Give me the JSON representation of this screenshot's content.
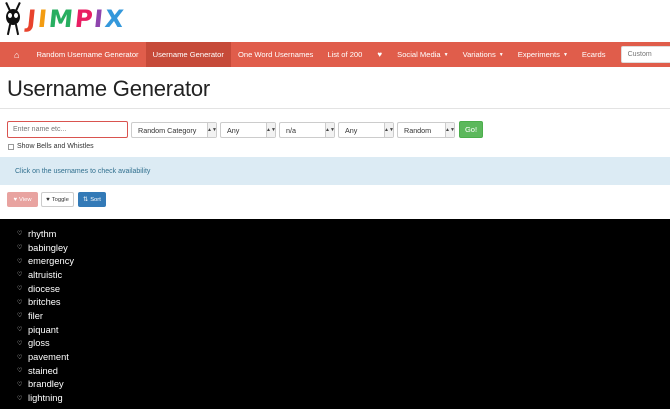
{
  "logo": {
    "letters": [
      "J",
      "I",
      "M",
      "P",
      "I",
      "X"
    ],
    "colors": [
      "#e8432d",
      "#f39c12",
      "#27ae60",
      "#e91e63",
      "#8e44ad",
      "#3498db"
    ]
  },
  "nav": {
    "items": [
      {
        "label": "Random Username Generator",
        "active": false
      },
      {
        "label": "Username Generator",
        "active": true
      },
      {
        "label": "One Word Usernames",
        "active": false
      },
      {
        "label": "List of 200",
        "active": false
      }
    ],
    "dropdowns": [
      {
        "label": "Social Media"
      },
      {
        "label": "Variations"
      },
      {
        "label": "Experiments"
      }
    ],
    "ecards": "Ecards",
    "search_placeholder": "Custom"
  },
  "page": {
    "title": "Username Generator"
  },
  "form": {
    "name_placeholder": "Enter name etc...",
    "selects": [
      "Random Category",
      "Any",
      "n/a",
      "Any",
      "Random"
    ],
    "go_label": "Go!",
    "checkbox_label": "Show Bells and Whistles"
  },
  "info": {
    "text": "Click on the usernames to check availability"
  },
  "buttons": {
    "view": "View",
    "toggle": "Toggle",
    "sort": "Sort"
  },
  "results": [
    "rhythm",
    "babingley",
    "emergency",
    "altruistic",
    "diocese",
    "britches",
    "filer",
    "piquant",
    "gloss",
    "pavement",
    "stained",
    "brandley",
    "lightning"
  ],
  "colors": {
    "navbar": "#e05d4b",
    "active": "#c64a39",
    "go": "#5cb85c",
    "sort": "#337ab7",
    "info_bg": "#dcebf4"
  }
}
